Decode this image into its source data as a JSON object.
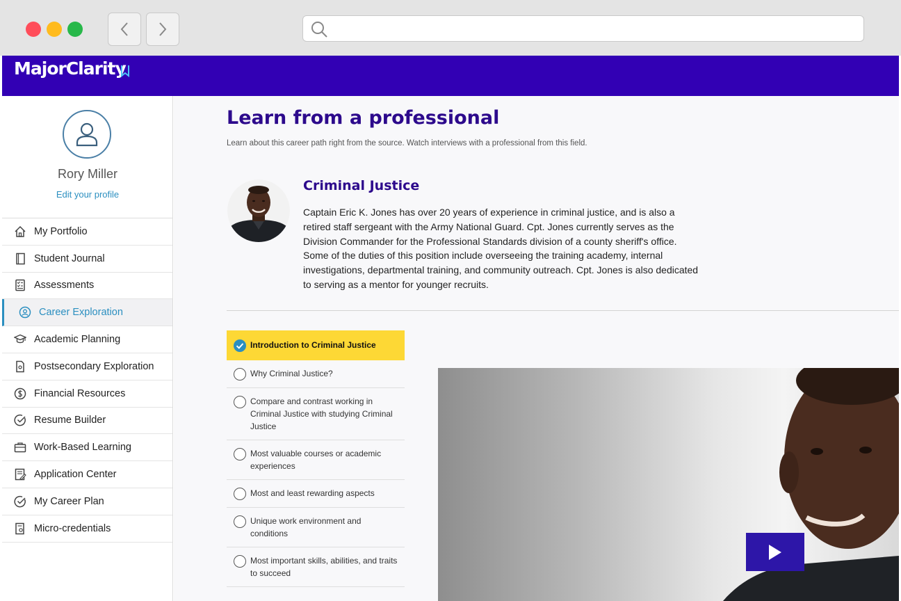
{
  "browser": {
    "url_value": "",
    "back_icon": "chevron-left-icon",
    "forward_icon": "chevron-right-icon",
    "search_icon": "search-icon"
  },
  "header": {
    "logo_text": "MajorClarity",
    "brand_color": "#3200b4"
  },
  "profile": {
    "name": "Rory Miller",
    "edit_link": "Edit your profile"
  },
  "sidebar": {
    "items": [
      {
        "label": "My Portfolio",
        "icon": "home-icon"
      },
      {
        "label": "Student Journal",
        "icon": "notebook-icon"
      },
      {
        "label": "Assessments",
        "icon": "checklist-icon"
      },
      {
        "label": "Career Exploration",
        "icon": "user-circle-icon",
        "active": true
      },
      {
        "label": "Academic Planning",
        "icon": "graduation-cap-icon"
      },
      {
        "label": "Postsecondary Exploration",
        "icon": "document-icon"
      },
      {
        "label": "Financial Resources",
        "icon": "dollar-icon"
      },
      {
        "label": "Resume Builder",
        "icon": "check-circle-icon"
      },
      {
        "label": "Work-Based Learning",
        "icon": "briefcase-icon"
      },
      {
        "label": "Application Center",
        "icon": "application-icon"
      },
      {
        "label": "My Career Plan",
        "icon": "check-circle-icon"
      },
      {
        "label": "Micro-credentials",
        "icon": "certificate-icon"
      }
    ]
  },
  "main": {
    "title": "Learn from a professional",
    "subtitle": "Learn about this career path right from the source. Watch interviews with a professional from this field.",
    "career": {
      "title": "Criminal Justice",
      "description": "Captain Eric K. Jones has over 20 years of experience in criminal justice, and is also a retired staff sergeant with the Army National Guard. Cpt. Jones currently serves as the Division Commander for the Professional Standards division of a county sheriff's office. Some of the duties of this position include overseeing the training academy, internal investigations, departmental training, and community outreach. Cpt. Jones is also dedicated to serving as a mentor for younger recruits."
    },
    "topics": [
      {
        "label": "Introduction to Criminal Justice",
        "active": true
      },
      {
        "label": "Why Criminal Justice?"
      },
      {
        "label": "Compare and contrast working in Criminal Justice with studying Criminal Justice"
      },
      {
        "label": "Most valuable courses or academic experiences"
      },
      {
        "label": "Most and least rewarding aspects"
      },
      {
        "label": "Unique work environment and conditions"
      },
      {
        "label": "Most important skills, abilities, and traits to succeed"
      }
    ],
    "video": {
      "play_icon": "play-icon",
      "button_color": "#2d16a8"
    }
  },
  "colors": {
    "accent_blue": "#2b8fc0",
    "title_purple": "#2d0a8c",
    "active_topic": "#fdd835"
  }
}
